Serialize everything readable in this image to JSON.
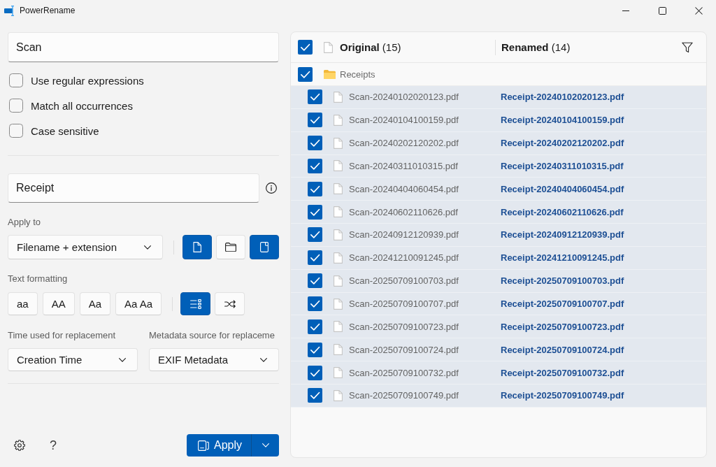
{
  "window": {
    "title": "PowerRename"
  },
  "search": {
    "value": "Scan",
    "options": [
      {
        "label": "Use regular expressions",
        "checked": false
      },
      {
        "label": "Match all occurrences",
        "checked": false
      },
      {
        "label": "Case sensitive",
        "checked": false
      }
    ]
  },
  "replace": {
    "value": "Receipt"
  },
  "apply_to": {
    "label": "Apply to",
    "value": "Filename + extension",
    "toggles": [
      {
        "kind": "files",
        "selected": true
      },
      {
        "kind": "folders",
        "selected": false
      },
      {
        "kind": "extension",
        "selected": true
      }
    ]
  },
  "text_formatting": {
    "label": "Text formatting",
    "case_buttons": [
      {
        "label": "aa",
        "selected": false
      },
      {
        "label": "AA",
        "selected": false
      },
      {
        "label": "Aa",
        "selected": false
      },
      {
        "label": "Aa Aa",
        "selected": false
      }
    ],
    "toggles": [
      {
        "kind": "enumerate",
        "selected": true
      },
      {
        "kind": "randomize",
        "selected": false
      }
    ]
  },
  "time_source": {
    "label": "Time used for replacement",
    "value": "Creation Time"
  },
  "metadata_source": {
    "label": "Metadata source for replaceme",
    "value": "EXIF Metadata"
  },
  "footer": {
    "help": "?",
    "apply_button": "Apply"
  },
  "file_list": {
    "header": {
      "checked": true,
      "original": "**Original** (15)",
      "renamed": "**Renamed** (14)"
    },
    "items": [
      {
        "kind": "folder",
        "name": "Receipts",
        "checked": true,
        "highlighted": false,
        "children": [
          {
            "kind": "file",
            "name": "Scan-20240102020123.pdf",
            "new_name": "Receipt-20240102020123.pdf",
            "checked": true,
            "highlighted": true
          },
          {
            "kind": "file",
            "name": "Scan-20240104100159.pdf",
            "new_name": "Receipt-20240104100159.pdf",
            "checked": true,
            "highlighted": true
          },
          {
            "kind": "file",
            "name": "Scan-20240202120202.pdf",
            "new_name": "Receipt-20240202120202.pdf",
            "checked": true,
            "highlighted": true
          },
          {
            "kind": "file",
            "name": "Scan-20240311010315.pdf",
            "new_name": "Receipt-20240311010315.pdf",
            "checked": true,
            "highlighted": true
          },
          {
            "kind": "file",
            "name": "Scan-20240404060454.pdf",
            "new_name": "Receipt-20240404060454.pdf",
            "checked": true,
            "highlighted": true
          },
          {
            "kind": "file",
            "name": "Scan-20240602110626.pdf",
            "new_name": "Receipt-20240602110626.pdf",
            "checked": true,
            "highlighted": true
          },
          {
            "kind": "file",
            "name": "Scan-20240912120939.pdf",
            "new_name": "Receipt-20240912120939.pdf",
            "checked": true,
            "highlighted": true
          },
          {
            "kind": "file",
            "name": "Scan-20241210091245.pdf",
            "new_name": "Receipt-20241210091245.pdf",
            "checked": true,
            "highlighted": true
          },
          {
            "kind": "file",
            "name": "Scan-20250709100703.pdf",
            "new_name": "Receipt-20250709100703.pdf",
            "checked": true,
            "highlighted": true
          },
          {
            "kind": "file",
            "name": "Scan-20250709100707.pdf",
            "new_name": "Receipt-20250709100707.pdf",
            "checked": true,
            "highlighted": true
          },
          {
            "kind": "file",
            "name": "Scan-20250709100723.pdf",
            "new_name": "Receipt-20250709100723.pdf",
            "checked": true,
            "highlighted": true
          },
          {
            "kind": "file",
            "name": "Scan-20250709100724.pdf",
            "new_name": "Receipt-20250709100724.pdf",
            "checked": true,
            "highlighted": true
          },
          {
            "kind": "file",
            "name": "Scan-20250709100732.pdf",
            "new_name": "Receipt-20250709100732.pdf",
            "checked": true,
            "highlighted": true
          },
          {
            "kind": "file",
            "name": "Scan-20250709100749.pdf",
            "new_name": "Receipt-20250709100749.pdf",
            "checked": true,
            "highlighted": true
          }
        ]
      }
    ]
  }
}
